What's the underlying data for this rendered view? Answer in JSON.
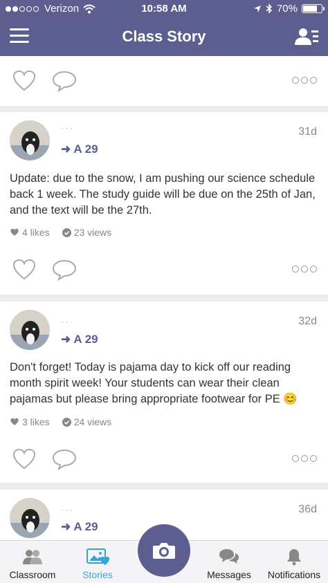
{
  "status_bar": {
    "carrier": "Verizon",
    "time": "10:58 AM",
    "battery": "70%",
    "battery_level": 0.7
  },
  "header": {
    "title": "Class Story"
  },
  "posts": [
    {
      "recipient": "A 29",
      "age": "31d",
      "text": "Update: due to the snow, I am pushing our science schedule back 1 week. The study guide will be due on the 25th of Jan, and the text will be the 27th.",
      "likes": "4 likes",
      "views": "23 views"
    },
    {
      "recipient": "A 29",
      "age": "32d",
      "text": "Don't forget! Today is pajama day to kick off our reading month spirit week! Your students can wear their clean pajamas but please bring appropriate footwear for PE 😊",
      "likes": "3 likes",
      "views": "24 views"
    },
    {
      "recipient": "A 29",
      "age": "36d"
    }
  ],
  "tabs": {
    "classroom": "Classroom",
    "stories": "Stories",
    "messages": "Messages",
    "notifications": "Notifications"
  },
  "colors": {
    "header": "#5b5e8e",
    "active_tab": "#37a4d8",
    "accent": "#5b5e8e"
  },
  "icons": [
    "menu-icon",
    "people-icon",
    "heart-icon",
    "comment-icon",
    "more-icon",
    "camera-icon",
    "classroom-icon",
    "stories-icon",
    "messages-icon",
    "notifications-icon"
  ]
}
